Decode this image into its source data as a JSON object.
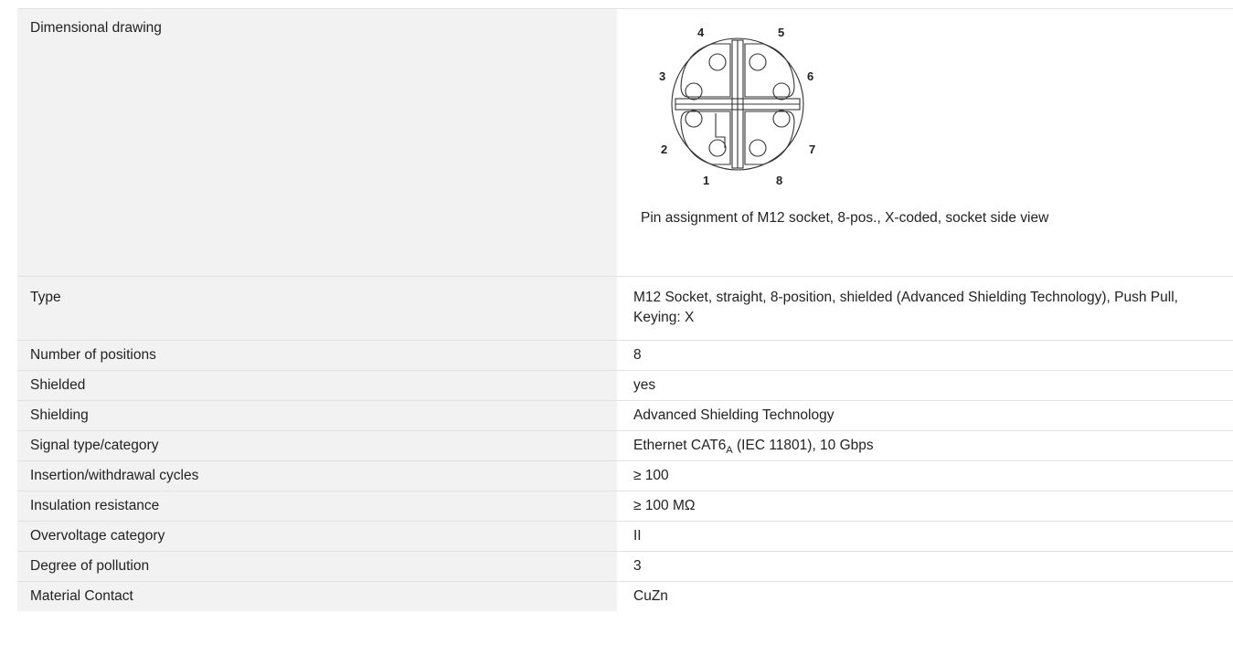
{
  "specs": {
    "drawing": {
      "label": "Dimensional drawing",
      "caption": "Pin assignment of M12 socket, 8-pos., X-coded, socket side view",
      "pin_numbers": [
        "1",
        "2",
        "3",
        "4",
        "5",
        "6",
        "7",
        "8"
      ]
    },
    "type": {
      "label": "Type",
      "value": "M12 Socket, straight, 8-position, shielded (Advanced Shielding Technology), Push Pull, Keying: X"
    },
    "positions": {
      "label": "Number of positions",
      "value": "8"
    },
    "shielded": {
      "label": "Shielded",
      "value": "yes"
    },
    "shielding": {
      "label": "Shielding",
      "value": "Advanced Shielding Technology"
    },
    "signal": {
      "label": "Signal type/category",
      "value_pre": "Ethernet CAT6",
      "value_sub": "A",
      "value_post": " (IEC 11801), 10 Gbps"
    },
    "cycles": {
      "label": "Insertion/withdrawal cycles",
      "value": "≥ 100"
    },
    "insulation": {
      "label": "Insulation resistance",
      "value": "≥ 100 MΩ"
    },
    "overvoltage": {
      "label": "Overvoltage category",
      "value": "II"
    },
    "pollution": {
      "label": "Degree of pollution",
      "value": "3"
    },
    "material": {
      "label": "Material Contact",
      "value": "CuZn"
    }
  }
}
